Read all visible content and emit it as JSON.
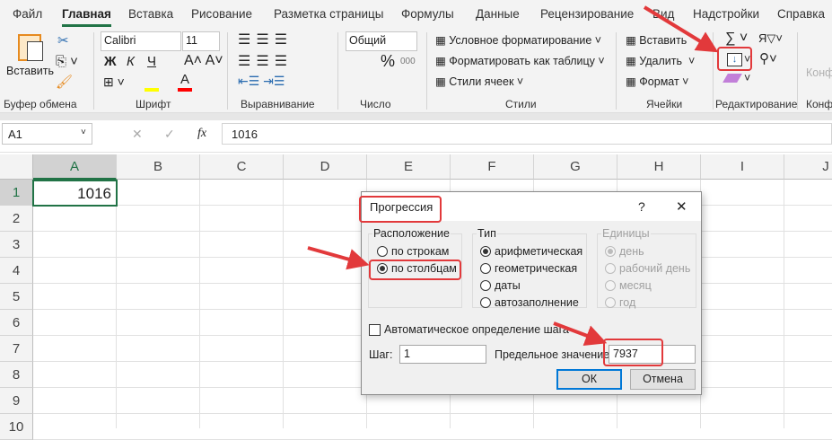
{
  "menu": {
    "tabs": [
      "Файл",
      "Главная",
      "Вставка",
      "Рисование",
      "Разметка страницы",
      "Формулы",
      "Данные",
      "Рецензирование",
      "Вид",
      "Надстройки",
      "Справка"
    ],
    "active": "Главная"
  },
  "ribbon": {
    "clipboard": {
      "paste": "Вставить",
      "label": "Буфер обмена"
    },
    "font": {
      "name": "Calibri",
      "size": "11",
      "bold": "Ж",
      "italic": "К",
      "underline": "Ч",
      "label": "Шрифт"
    },
    "alignment": {
      "label": "Выравнивание"
    },
    "number": {
      "format": "Общий",
      "percent": "%",
      "thousands": "000",
      "label": "Число"
    },
    "styles": {
      "conditional": "Условное форматирование",
      "as_table": "Форматировать как таблицу",
      "cell_styles": "Стили ячеек",
      "label": "Стили"
    },
    "cells": {
      "insert": "Вставить",
      "delete": "Удалить",
      "format": "Формат",
      "label": "Ячейки"
    },
    "editing": {
      "label": "Редактирование"
    },
    "next_group": "Конф"
  },
  "formula_bar": {
    "name_box": "A1",
    "fx": "fx",
    "value": "1016"
  },
  "sheet": {
    "columns": [
      "A",
      "B",
      "C",
      "D",
      "E",
      "F",
      "G",
      "H",
      "I",
      "J"
    ],
    "rows": [
      "1",
      "2",
      "3",
      "4",
      "5",
      "6",
      "7",
      "8",
      "9",
      "10"
    ],
    "cells": {
      "A1": "1016"
    }
  },
  "dialog": {
    "title": "Прогрессия",
    "help": "?",
    "close": "✕",
    "placement": {
      "label": "Расположение",
      "options": [
        "по строкам",
        "по столбцам"
      ],
      "selected": "по столбцам"
    },
    "type": {
      "label": "Тип",
      "options": [
        "арифметическая",
        "геометрическая",
        "даты",
        "автозаполнение"
      ],
      "selected": "арифметическая"
    },
    "units": {
      "label": "Единицы",
      "options": [
        "день",
        "рабочий день",
        "месяц",
        "год"
      ],
      "selected": "день",
      "disabled": true
    },
    "auto_step": {
      "label": "Автоматическое определение шага",
      "checked": false
    },
    "step": {
      "label": "Шаг:",
      "value": "1"
    },
    "limit": {
      "label": "Предельное значение:",
      "value": "7937"
    },
    "ok": "ОК",
    "cancel": "Отмена"
  },
  "colors": {
    "accent": "#217346",
    "highlight": "#e2393b"
  }
}
